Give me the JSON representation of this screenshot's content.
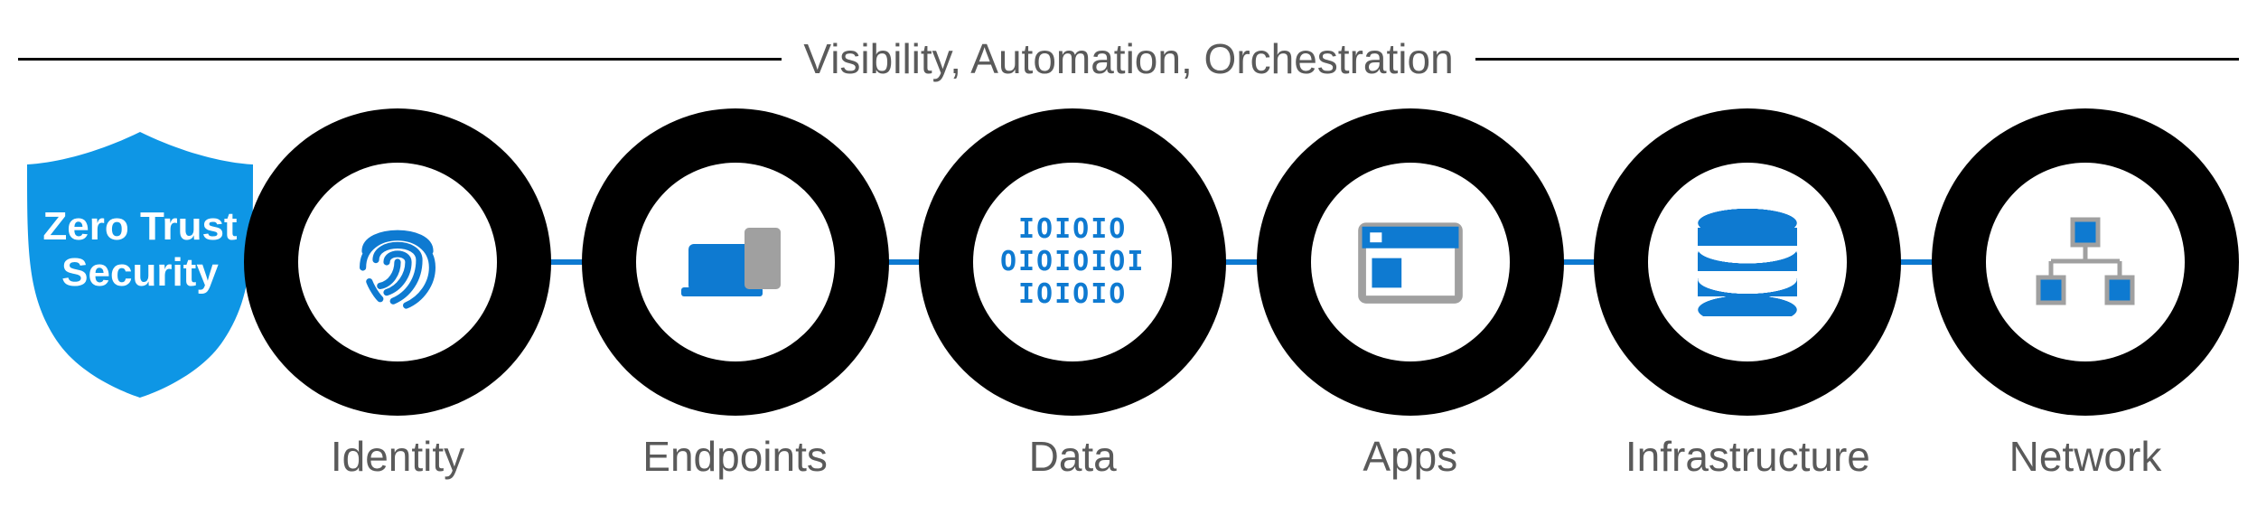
{
  "header": {
    "label": "Visibility, Automation, Orchestration"
  },
  "shield": {
    "title_line1": "Zero Trust",
    "title_line2": "Security"
  },
  "pillars": [
    {
      "id": "identity",
      "label": "Identity",
      "icon": "fingerprint-icon"
    },
    {
      "id": "endpoints",
      "label": "Endpoints",
      "icon": "devices-icon"
    },
    {
      "id": "data",
      "label": "Data",
      "icon": "binary-icon"
    },
    {
      "id": "apps",
      "label": "Apps",
      "icon": "app-window-icon"
    },
    {
      "id": "infrastructure",
      "label": "Infrastructure",
      "icon": "database-icon"
    },
    {
      "id": "network",
      "label": "Network",
      "icon": "network-icon"
    }
  ],
  "colors": {
    "accent": "#0e7ad1",
    "ring": "#000000",
    "muted_icon": "#a0a0a0",
    "text_muted": "#5a5a5a"
  },
  "binary_lines": [
    "IOIOIO",
    "OIOIOIOI",
    "IOIOIO"
  ]
}
